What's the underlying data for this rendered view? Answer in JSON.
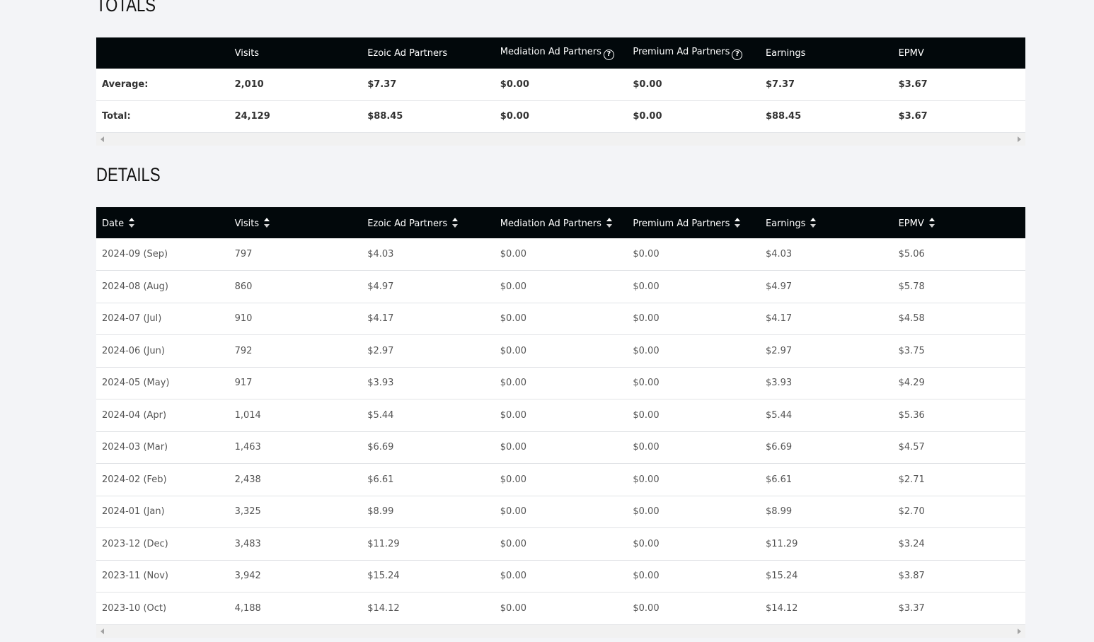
{
  "totals": {
    "title": "TOTALS",
    "headers": [
      "",
      "Visits",
      "Ezoic Ad Partners",
      "Mediation Ad Partners",
      "Premium Ad Partners",
      "Earnings",
      "EPMV"
    ],
    "rows": [
      [
        "Average:",
        "2,010",
        "$7.37",
        "$0.00",
        "$0.00",
        "$7.37",
        "$3.67"
      ],
      [
        "Total:",
        "24,129",
        "$88.45",
        "$0.00",
        "$0.00",
        "$88.45",
        "$3.67"
      ]
    ]
  },
  "details": {
    "title": "DETAILS",
    "headers": [
      "Date",
      "Visits",
      "Ezoic Ad Partners",
      "Mediation Ad Partners",
      "Premium Ad Partners",
      "Earnings",
      "EPMV"
    ],
    "rows": [
      [
        "2024-09 (Sep)",
        "797",
        "$4.03",
        "$0.00",
        "$0.00",
        "$4.03",
        "$5.06"
      ],
      [
        "2024-08 (Aug)",
        "860",
        "$4.97",
        "$0.00",
        "$0.00",
        "$4.97",
        "$5.78"
      ],
      [
        "2024-07 (Jul)",
        "910",
        "$4.17",
        "$0.00",
        "$0.00",
        "$4.17",
        "$4.58"
      ],
      [
        "2024-06 (Jun)",
        "792",
        "$2.97",
        "$0.00",
        "$0.00",
        "$2.97",
        "$3.75"
      ],
      [
        "2024-05 (May)",
        "917",
        "$3.93",
        "$0.00",
        "$0.00",
        "$3.93",
        "$4.29"
      ],
      [
        "2024-04 (Apr)",
        "1,014",
        "$5.44",
        "$0.00",
        "$0.00",
        "$5.44",
        "$5.36"
      ],
      [
        "2024-03 (Mar)",
        "1,463",
        "$6.69",
        "$0.00",
        "$0.00",
        "$6.69",
        "$4.57"
      ],
      [
        "2024-02 (Feb)",
        "2,438",
        "$6.61",
        "$0.00",
        "$0.00",
        "$6.61",
        "$2.71"
      ],
      [
        "2024-01 (Jan)",
        "3,325",
        "$8.99",
        "$0.00",
        "$0.00",
        "$8.99",
        "$2.70"
      ],
      [
        "2023-12 (Dec)",
        "3,483",
        "$11.29",
        "$0.00",
        "$0.00",
        "$11.29",
        "$3.24"
      ],
      [
        "2023-11 (Nov)",
        "3,942",
        "$15.24",
        "$0.00",
        "$0.00",
        "$15.24",
        "$3.87"
      ],
      [
        "2023-10 (Oct)",
        "4,188",
        "$14.12",
        "$0.00",
        "$0.00",
        "$14.12",
        "$3.37"
      ]
    ]
  },
  "icons": {
    "help": "?"
  }
}
